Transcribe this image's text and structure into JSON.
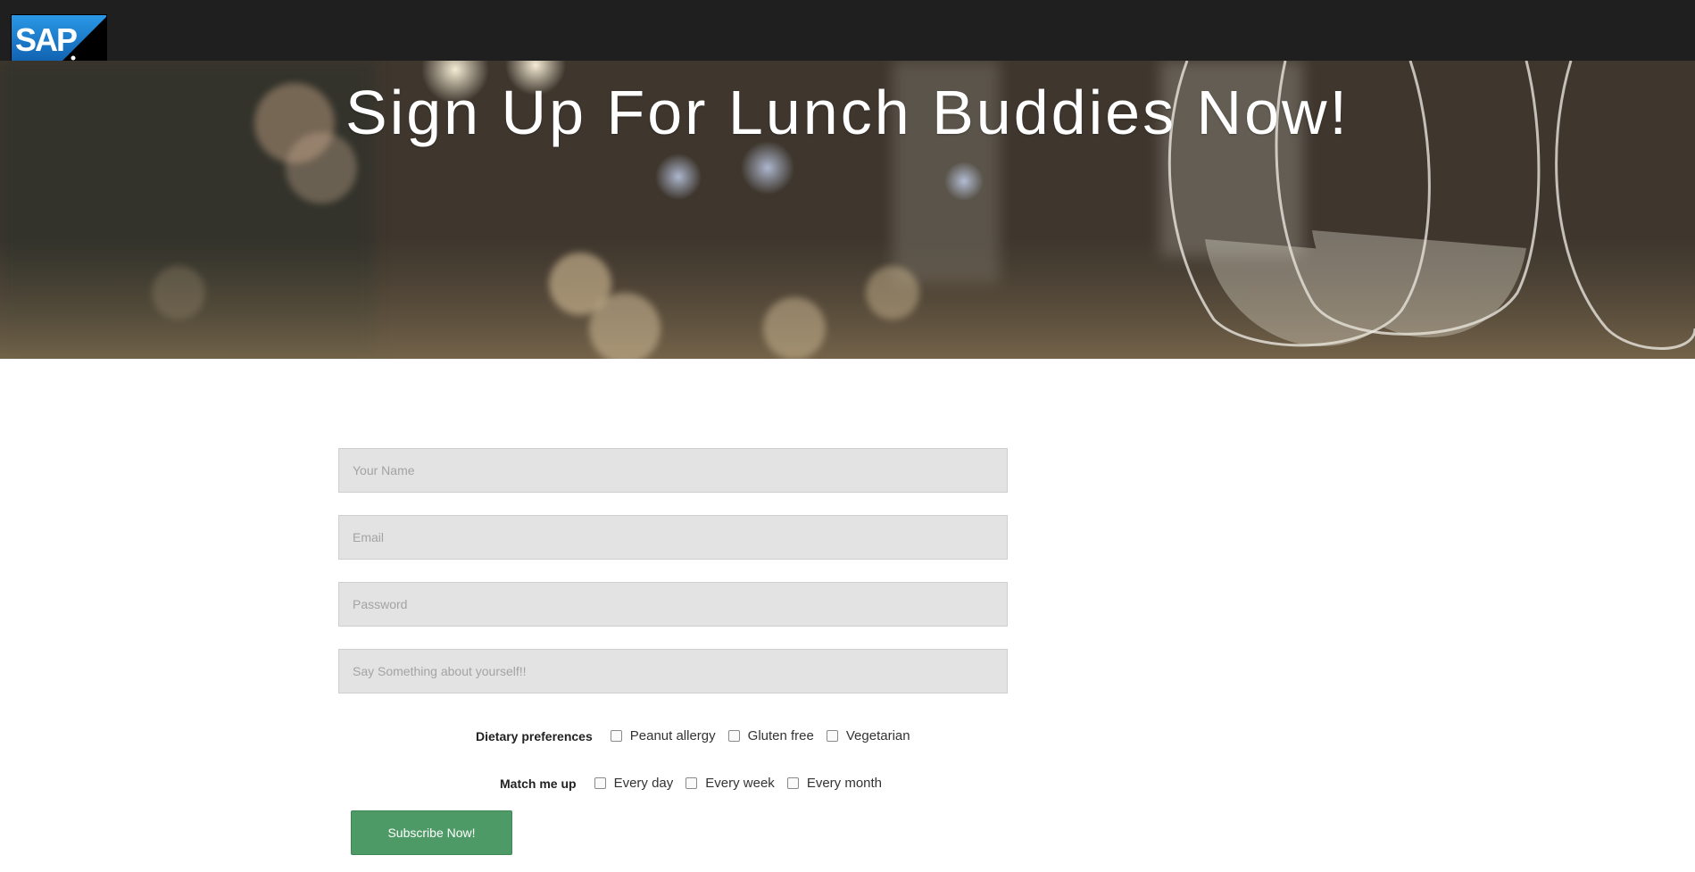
{
  "header": {
    "logo_text": "SAP"
  },
  "hero": {
    "title": "Sign Up For Lunch Buddies Now!"
  },
  "form": {
    "name_placeholder": "Your Name",
    "email_placeholder": "Email",
    "password_placeholder": "Password",
    "about_placeholder": "Say Something about yourself!!"
  },
  "dietary": {
    "label": "Dietary preferences",
    "options": [
      "Peanut allergy",
      "Gluten free",
      "Vegetarian"
    ]
  },
  "match": {
    "label": "Match me up",
    "options": [
      "Every day",
      "Every week",
      "Every month"
    ]
  },
  "submit_label": "Subscribe Now!",
  "colors": {
    "topbar": "#1f1f1f",
    "field_bg": "#e3e3e3",
    "button": "#4e9a66",
    "logo_blue": "#1b7fd0"
  }
}
